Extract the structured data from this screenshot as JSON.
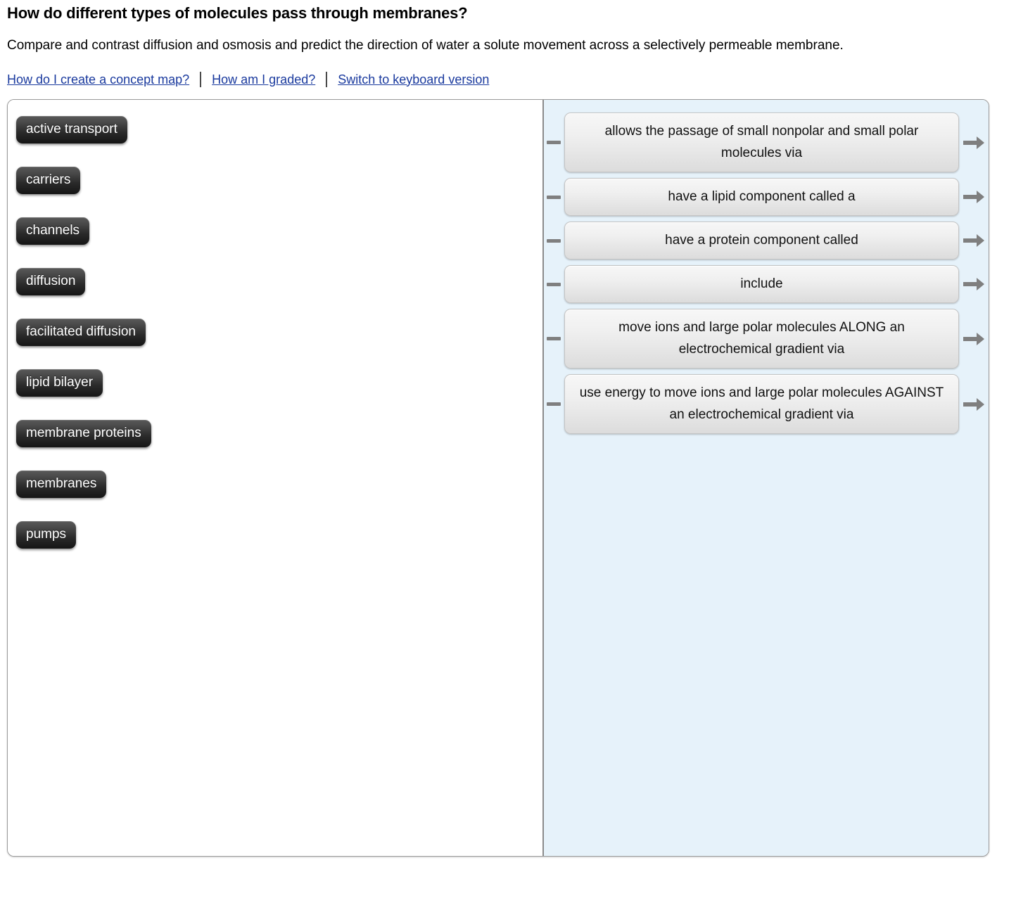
{
  "header": {
    "title": "How do different types of molecules pass through membranes?",
    "subtitle": "Compare and contrast diffusion and osmosis and predict the direction of water a solute movement across a selectively permeable membrane."
  },
  "links": [
    {
      "label": "How do I create a concept map?"
    },
    {
      "label": "How am I graded?"
    },
    {
      "label": "Switch to keyboard version"
    }
  ],
  "colors": {
    "link": "#1a3a9e",
    "panel_background": "#e6f2fa",
    "canvas_background": "#ffffff",
    "chip_text": "#ffffff",
    "connector": "#7f7f7f",
    "container_border": "#9a9a9a"
  },
  "concept_map": {
    "terms": [
      {
        "label": "active transport"
      },
      {
        "label": "carriers"
      },
      {
        "label": "channels"
      },
      {
        "label": "diffusion"
      },
      {
        "label": "facilitated diffusion"
      },
      {
        "label": "lipid bilayer"
      },
      {
        "label": "membrane proteins"
      },
      {
        "label": "membranes"
      },
      {
        "label": "pumps"
      }
    ],
    "linking_phrases": [
      {
        "label": "allows the passage of small nonpolar and small polar molecules via"
      },
      {
        "label": "have a lipid component called a"
      },
      {
        "label": "have a protein component called"
      },
      {
        "label": "include"
      },
      {
        "label": "move ions and large polar molecules ALONG an electrochemical gradient via"
      },
      {
        "label": "use energy to move ions and large polar molecules AGAINST an electrochemical gradient via"
      }
    ]
  }
}
